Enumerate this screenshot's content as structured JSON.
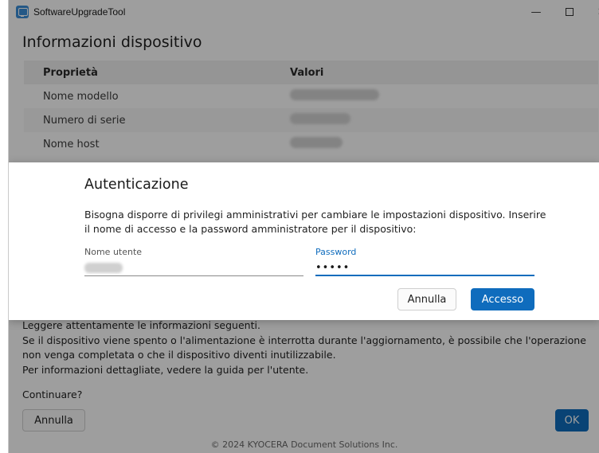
{
  "window": {
    "title": "SoftwareUpgradeTool",
    "minimize_glyph": "—",
    "close_glyph": "✕"
  },
  "device_info": {
    "title": "Informazioni dispositivo",
    "col_property": "Proprietà",
    "col_values": "Valori",
    "rows": [
      {
        "name": "Nome modello"
      },
      {
        "name": "Numero di serie"
      },
      {
        "name": "Nome host"
      }
    ]
  },
  "warning": {
    "line1": "Leggere attentamente le informazioni seguenti.",
    "line2": "Se il dispositivo viene spento o l'alimentazione è interrotta durante l'aggiornamento, è possibile che l'operazione non venga completata o che il dispositivo diventi inutilizzabile.",
    "line3": "Per informazioni dettagliate, vedere la guida per l'utente.",
    "continue": "Continuare?"
  },
  "main_buttons": {
    "cancel": "Annulla",
    "ok": "OK"
  },
  "footer": "© 2024 KYOCERA Document Solutions Inc.",
  "dialog": {
    "title": "Autenticazione",
    "message": "Bisogna disporre di privilegi amministrativi per cambiare le impostazioni dispositivo. Inserire il nome di accesso e la password amministratore per il dispositivo:",
    "username_label": "Nome utente",
    "password_label": "Password",
    "password_mask": "•••••",
    "cancel": "Annulla",
    "login": "Accesso"
  },
  "colors": {
    "accent": "#0f6cbd",
    "overlay": "rgba(0,0,0,0.38)"
  }
}
